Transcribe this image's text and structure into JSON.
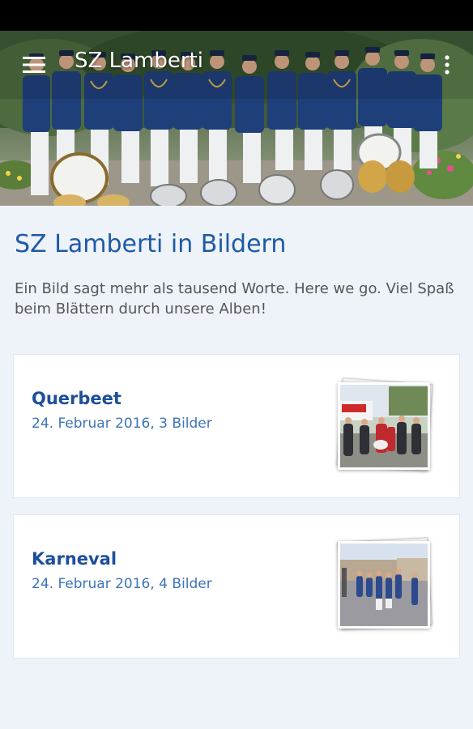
{
  "app": {
    "title": "SZ Lamberti"
  },
  "icons": {
    "menu": "menu-icon",
    "overflow": "more-vertical-icon"
  },
  "page": {
    "heading": "SZ Lamberti in Bildern",
    "intro": "Ein Bild sagt mehr als tausend Worte. Here we go. Viel Spaß beim Blättern durch unsere Alben!"
  },
  "albums": [
    {
      "title": "Querbeet",
      "meta": "24. Februar 2016, 3 Bilder"
    },
    {
      "title": "Karneval",
      "meta": "24. Februar 2016, 4 Bilder"
    }
  ],
  "colors": {
    "accent": "#1d5aa8",
    "background": "#eef3f9",
    "card": "#ffffff",
    "meta": "#3d74b8"
  }
}
